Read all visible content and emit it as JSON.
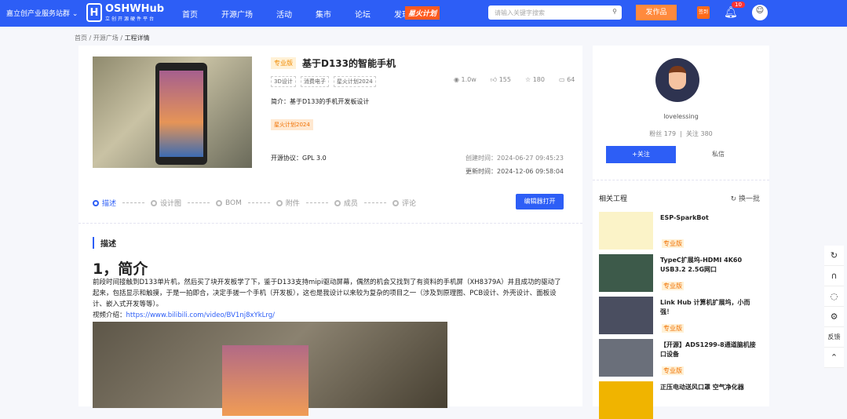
{
  "header": {
    "site": "嘉立创产业服务站群",
    "logo_name": "OSHWHub",
    "logo_sub": "立创开源硬件平台",
    "nav": [
      "首页",
      "开源广场",
      "活动",
      "集市",
      "论坛",
      "发现"
    ],
    "spark": "星火计划",
    "search_placeholder": "请输入关键字搜索",
    "publish": "发作品",
    "calendar": "签到",
    "notifications": "10"
  },
  "breadcrumb": [
    "首页",
    "开源广场",
    "工程详情"
  ],
  "project": {
    "level": "专业版",
    "title": "基于D133的智能手机",
    "tags": [
      "3D设计",
      "消费电子",
      "星火计划2024"
    ],
    "views": "1.0w",
    "likes": "155",
    "stars": "180",
    "comments": "64",
    "intro": "简介：基于D133的手机开发板设计",
    "activity_tag": "星火计划2024",
    "license": "开源协议：GPL 3.0",
    "created": "创建时间：2024-06-27 09:45:23",
    "updated": "更新时间：2024-12-06 09:58:04"
  },
  "tabs": [
    "描述",
    "设计图",
    "BOM",
    "附件",
    "成员",
    "评论"
  ],
  "edit_button": "编辑器打开",
  "content": {
    "section": "描述",
    "heading": "1，简介",
    "paragraph": "前段时间接触到D133单片机，然后买了块开发板学了下，鉴于D133支持mipi驱动屏幕，偶然的机会又找到了有资料的手机屏（XH8379A）并且成功的驱动了起来，包括显示和触摸，于是一拍即合，决定手搓一个手机（开发板），这也是我设计以来较为复杂的项目之一（涉及到原理图、PCB设计、外壳设计、面板设计、嵌入式开发等等）。",
    "video_label": "视频介绍：",
    "video_url": "https://www.bilibili.com/video/BV1nj8xYkLrg/"
  },
  "user": {
    "name": "lovelessing",
    "fans_label": "粉丝",
    "fans": "179",
    "following_label": "关注",
    "following": "380",
    "follow": "+关注",
    "message": "私信"
  },
  "related": {
    "title": "相关工程",
    "refresh": "换一批",
    "items": [
      {
        "name": "ESP-SparkBot",
        "level": "专业版"
      },
      {
        "name": "TypeC扩展坞-HDMI 4K60 USB3.2 2.5G网口",
        "level": "专业版"
      },
      {
        "name": "Link Hub 计算机扩展坞，小而强！",
        "level": "专业版"
      },
      {
        "name": "【开源】ADS1299-8通道脑机接口设备",
        "level": "专业版"
      },
      {
        "name": "正压电动送风口罩 空气净化器",
        "level": ""
      }
    ]
  },
  "tools": {
    "feedback": "反馈"
  }
}
